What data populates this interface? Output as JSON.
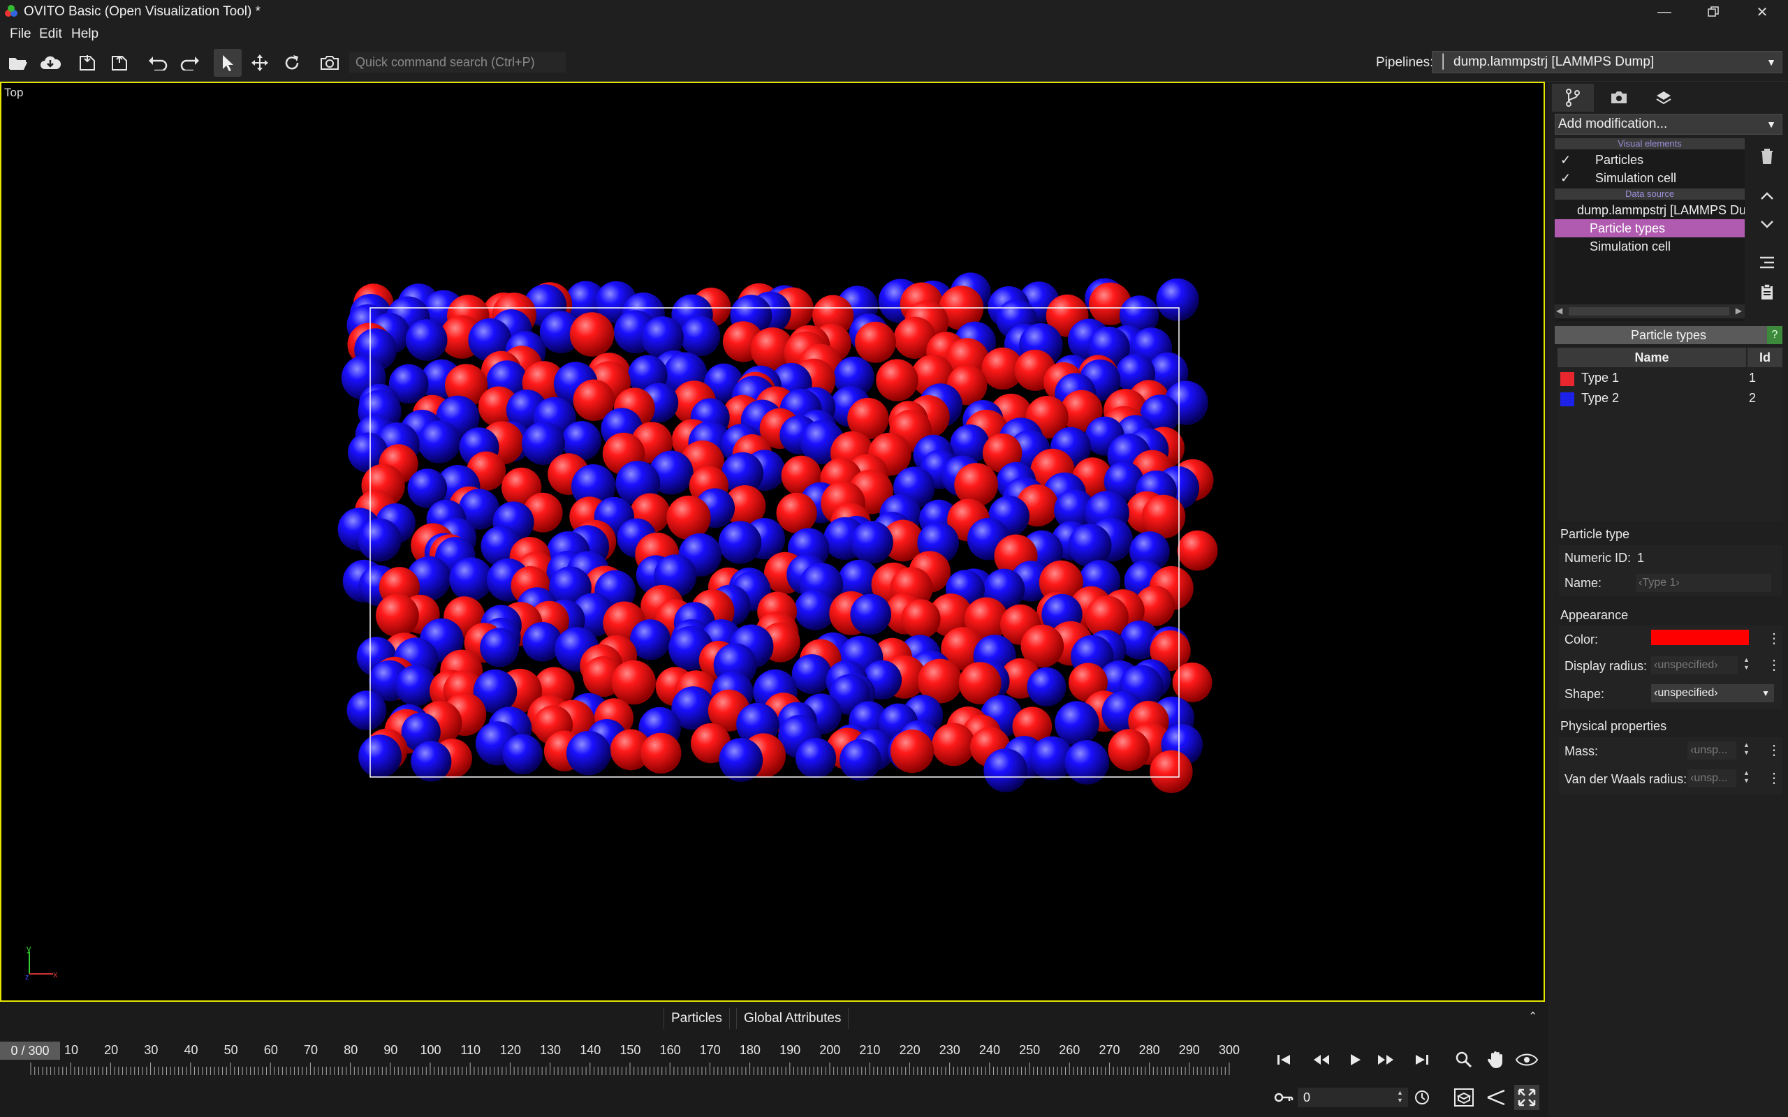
{
  "window": {
    "title": "OVITO Basic (Open Visualization Tool) *",
    "controls": [
      "minimize-icon",
      "restore-icon",
      "close-icon"
    ]
  },
  "menubar": [
    "File",
    "Edit",
    "Help"
  ],
  "toolbar": {
    "search_placeholder": "Quick command search (Ctrl+P)",
    "pipelines_label": "Pipelines:",
    "pipelines_value": "dump.lammpstrj [LAMMPS Dump]"
  },
  "viewport": {
    "label": "Top",
    "axes": {
      "x": "x",
      "y": "y",
      "z": "z"
    },
    "colors": {
      "type1": "#ff0000",
      "type2": "#1a10ff",
      "cell": "#ffffff",
      "border": "#e6e600"
    }
  },
  "data_tabs": [
    "Particles",
    "Global Attributes"
  ],
  "timeline": {
    "current": "0 / 300",
    "labels": [
      "10",
      "20",
      "30",
      "40",
      "50",
      "60",
      "70",
      "80",
      "90",
      "100",
      "110",
      "120",
      "130",
      "140",
      "150",
      "160",
      "170",
      "180",
      "190",
      "200",
      "210",
      "220",
      "230",
      "240",
      "250",
      "260",
      "270",
      "280",
      "290",
      "300"
    ],
    "frame_value": "0"
  },
  "right_panel": {
    "add_modification": "Add modification...",
    "visual_elements_header": "Visual elements",
    "visual_elements": [
      {
        "label": "Particles",
        "checked": true
      },
      {
        "label": "Simulation cell",
        "checked": true
      }
    ],
    "data_source_header": "Data source",
    "data_source": "dump.lammpstrj [LAMMPS Dump]",
    "data_source_children": [
      "Particle types",
      "Simulation cell"
    ],
    "particle_types_title": "Particle types",
    "help": "?",
    "table": {
      "headers": [
        "Name",
        "Id"
      ],
      "rows": [
        {
          "name": "Type 1",
          "id": "1",
          "color": "#e8262e"
        },
        {
          "name": "Type 2",
          "id": "2",
          "color": "#1c22e8"
        }
      ]
    },
    "particle_type": {
      "section": "Particle type",
      "numeric_id_label": "Numeric ID:",
      "numeric_id": "1",
      "name_label": "Name:",
      "name_placeholder": "‹Type 1›"
    },
    "appearance": {
      "section": "Appearance",
      "color_label": "Color:",
      "color": "#ff0000",
      "radius_label": "Display radius:",
      "radius_value": "‹unspecified›",
      "shape_label": "Shape:",
      "shape_value": "‹unspecified›"
    },
    "physical": {
      "section": "Physical properties",
      "mass_label": "Mass:",
      "mass_value": "‹unsp...",
      "vdw_label": "Van der Waals radius:",
      "vdw_value": "‹unsp..."
    }
  }
}
